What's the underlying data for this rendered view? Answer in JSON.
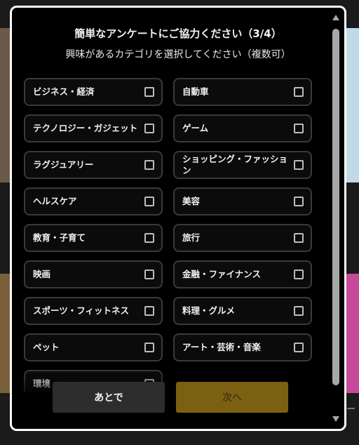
{
  "survey": {
    "title": "簡単なアンケートにご協力ください（3/4）",
    "subtitle": "興味があるカテゴリを選択してください（複数可）",
    "options": [
      {
        "label": "ビジネス・経済",
        "checked": false
      },
      {
        "label": "自動車",
        "checked": false
      },
      {
        "label": "テクノロジー・ガジェット",
        "checked": false
      },
      {
        "label": "ゲーム",
        "checked": false
      },
      {
        "label": "ラグジュアリー",
        "checked": false
      },
      {
        "label": "ショッピング・ファッション",
        "checked": false
      },
      {
        "label": "ヘルスケア",
        "checked": false
      },
      {
        "label": "美容",
        "checked": false
      },
      {
        "label": "教育・子育て",
        "checked": false
      },
      {
        "label": "旅行",
        "checked": false
      },
      {
        "label": "映画",
        "checked": false
      },
      {
        "label": "金融・ファイナンス",
        "checked": false
      },
      {
        "label": "スポーツ・フィットネス",
        "checked": false
      },
      {
        "label": "料理・グルメ",
        "checked": false
      },
      {
        "label": "ペット",
        "checked": false
      },
      {
        "label": "アート・芸術・音楽",
        "checked": false
      },
      {
        "label": "環境",
        "checked": false
      }
    ],
    "later_label": "あとで",
    "next_label": "次へ"
  },
  "background": {
    "side_text": "ー"
  },
  "colors": {
    "modal_bg": "#000000",
    "modal_border": "#ffffff",
    "option_border": "#3a3a3a",
    "next_button_disabled": "#7a6010",
    "later_button": "#2d2d2d"
  }
}
